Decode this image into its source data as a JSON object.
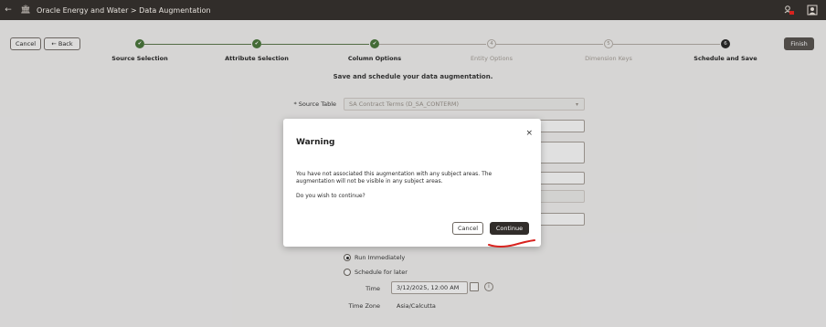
{
  "topbar": {
    "back_glyph": "←",
    "app_icon": "🏛",
    "title": "Oracle Energy and Water > Data Augmentation",
    "right_icons": [
      "notification-icon",
      "user-icon"
    ]
  },
  "toolbar": {
    "cancel_label": "Cancel",
    "back_label": "← Back",
    "finish_label": "Finish"
  },
  "train": {
    "stops": [
      {
        "label": "Source Selection",
        "state": "done",
        "glyph": "✔"
      },
      {
        "label": "Attribute Selection",
        "state": "done",
        "glyph": "✔"
      },
      {
        "label": "Column Options",
        "state": "done",
        "glyph": "✔"
      },
      {
        "label": "Entity Options",
        "state": "pending",
        "glyph": "4"
      },
      {
        "label": "Dimension Keys",
        "state": "pending",
        "glyph": "5"
      },
      {
        "label": "Schedule and Save",
        "state": "current",
        "glyph": "6"
      }
    ]
  },
  "page": {
    "subtitle": "Save and schedule your data augmentation."
  },
  "form": {
    "source_table_label": "* Source Table",
    "source_table_value": "SA Contract Terms (D_SA_CONTERM)",
    "run_immediately": "Run Immediately",
    "schedule_later": "Schedule for later",
    "time_label": "Time",
    "time_value": "3/12/2025, 12:00 AM",
    "timezone_label": "Time Zone",
    "timezone_value": "Asia/Calcutta"
  },
  "dialog": {
    "title": "Warning",
    "close_glyph": "×",
    "message": "You have not associated this augmentation with any subject areas. The augmentation will not be visible in any subject areas.",
    "question": "Do you wish to continue?",
    "cancel_label": "Cancel",
    "continue_label": "Continue"
  },
  "colors": {
    "topbar": "#312d2a",
    "done": "#4d7a3e",
    "annotation": "#d8231f"
  }
}
